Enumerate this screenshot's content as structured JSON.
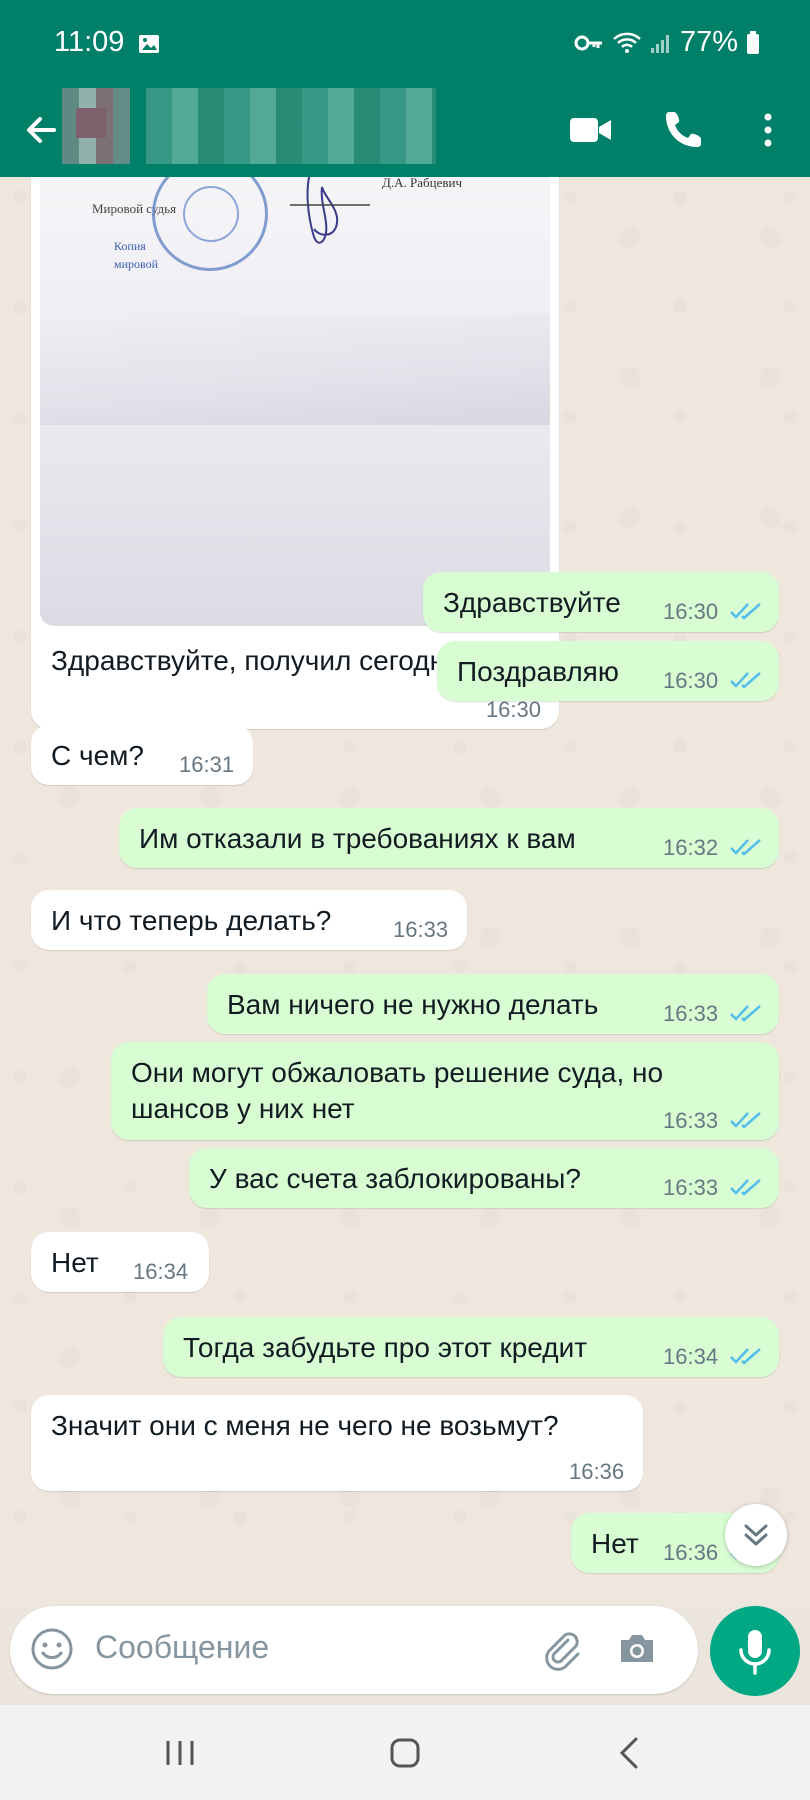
{
  "status_bar": {
    "time": "11:09",
    "battery": "77%"
  },
  "app_bar": {
    "contact_name": ""
  },
  "photo": {
    "doc_text_1": "Мировой судья",
    "doc_text_2": "Д.А. Рабцевич",
    "doc_blue_1": "Копия",
    "doc_blue_2": "мировой"
  },
  "messages": [
    {
      "dir": "in",
      "text": "Здравствуйте, получил сегодня.",
      "time": "16:30"
    },
    {
      "dir": "out",
      "text": "Здравствуйте",
      "time": "16:30",
      "status": "read"
    },
    {
      "dir": "out",
      "text": "Поздравляю",
      "time": "16:30",
      "status": "read"
    },
    {
      "dir": "in",
      "text": "С чем?",
      "time": "16:31"
    },
    {
      "dir": "out",
      "text": "Им отказали в требованиях к вам",
      "time": "16:32",
      "status": "read"
    },
    {
      "dir": "in",
      "text": "И что теперь делать?",
      "time": "16:33"
    },
    {
      "dir": "out",
      "text": "Вам ничего не нужно делать",
      "time": "16:33",
      "status": "read"
    },
    {
      "dir": "out",
      "text_line1": "Они могут обжаловать решение суда, но",
      "text_line2": "шансов у них нет",
      "time": "16:33",
      "status": "read"
    },
    {
      "dir": "out",
      "text": "У вас счета заблокированы?",
      "time": "16:33",
      "status": "read"
    },
    {
      "dir": "in",
      "text": "Нет",
      "time": "16:34"
    },
    {
      "dir": "out",
      "text": "Тогда забудьте про этот кредит",
      "time": "16:34",
      "status": "read"
    },
    {
      "dir": "in",
      "text": "Значит они с меня не чего не возьмут?",
      "time": "16:36"
    },
    {
      "dir": "out",
      "text": "Нет",
      "time": "16:36",
      "status": "read"
    }
  ],
  "composer": {
    "placeholder": "Сообщение"
  },
  "colors": {
    "header": "#008069",
    "outgoing_bubble": "#d9fdd3",
    "incoming_bubble": "#ffffff",
    "read_ticks": "#53bdeb",
    "mic_button": "#00a884"
  }
}
